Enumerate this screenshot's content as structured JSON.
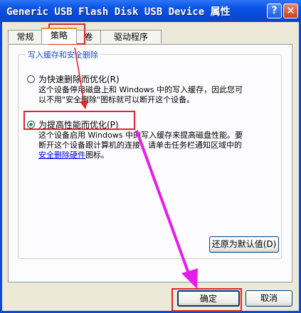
{
  "window": {
    "title": "Generic USB Flash Disk USB Device 属性"
  },
  "titlebar": {
    "help_label": "?",
    "close_label": "✕"
  },
  "tabs": [
    {
      "label": "常规"
    },
    {
      "label": "策略"
    },
    {
      "label": "卷"
    },
    {
      "label": "驱动程序"
    }
  ],
  "group": {
    "title": "写入缓存和安全删除"
  },
  "option1": {
    "label": "为快速删除而优化(R)",
    "desc_line1": "这个设备停用磁盘上和 Windows 中的写入缓存，因此您可",
    "desc_line2": "以不用\"安全删除\"图标就可以断开这个设备。"
  },
  "option2": {
    "label": "为提高性能而优化(P)",
    "desc_line1": "这个设备启用 Windows 中的写入缓存来提高磁盘性能。要",
    "desc_line2": "断开这个设备跟计算机的连接，请单击任务栏通知区域中的",
    "desc_link": "安全删除硬件",
    "desc_tail": "图标。"
  },
  "buttons": {
    "restore_default": "还原为默认值(D)",
    "ok": "确定",
    "cancel": "取消"
  },
  "colors": {
    "annotation_red": "#E3242B",
    "annotation_arrow": "#E81CE8"
  }
}
